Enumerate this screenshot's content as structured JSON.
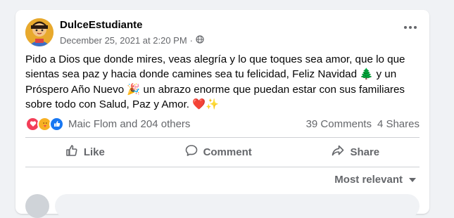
{
  "post": {
    "author": "DulceEstudiante",
    "timestamp": "December 25, 2021 at 2:20 PM",
    "separator": "·",
    "privacy_icon": "globe-icon",
    "text_part1": "Pido a Dios que donde mires, veas alegría y lo que toques sea amor, que lo que sientas sea paz y hacia donde camines sea tu felicidad, Feliz Navidad ",
    "emoji_tree": "🌲",
    "text_part2": " y un Próspero Año Nuevo ",
    "emoji_party": "🎉",
    "text_part3": " un abrazo enorme que puedan estar con sus familiares sobre todo con Salud, Paz y Amor. ",
    "emoji_heart": "❤️",
    "emoji_sparkles": "✨"
  },
  "reactions": {
    "icons": [
      "love-icon",
      "care-icon",
      "like-icon"
    ],
    "summary": "Maic Flom and 204 others",
    "comments": "39 Comments",
    "shares": "4 Shares"
  },
  "actions": {
    "like": "Like",
    "comment": "Comment",
    "share": "Share"
  },
  "comments": {
    "sort_label": "Most relevant"
  },
  "colors": {
    "background": "#f0f2f5",
    "card": "#ffffff",
    "secondary_text": "#65676b",
    "like_blue": "#1877f2",
    "love_red": "#f33e58",
    "care_yellow": "#f7b125"
  }
}
